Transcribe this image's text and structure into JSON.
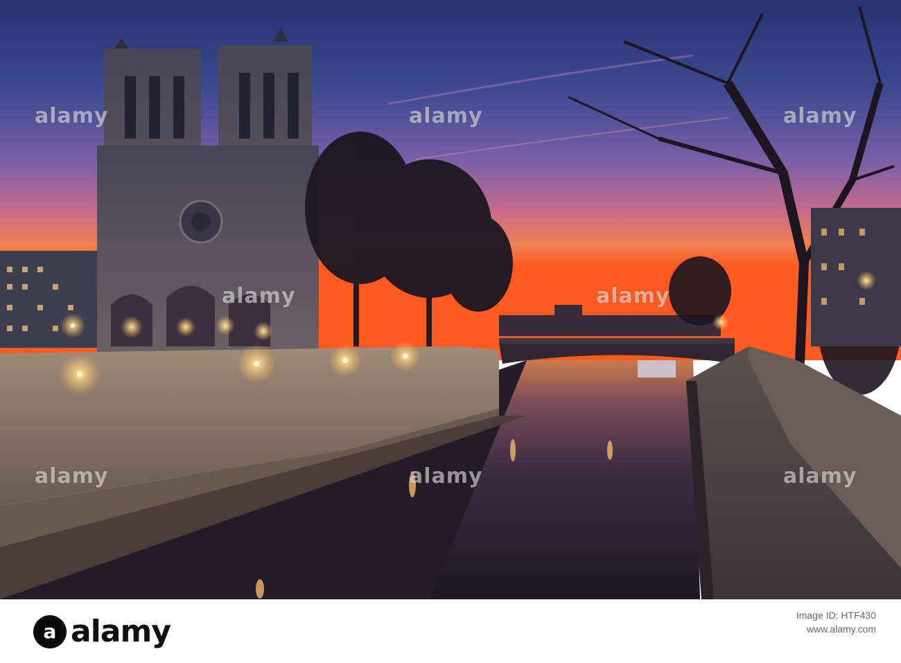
{
  "watermark": {
    "text": "alamy"
  },
  "footer": {
    "brand_text": "alamy",
    "brand_mark": "a",
    "image_id_label": "Image ID: HTF430",
    "url": "www.alamy.com"
  },
  "colors": {
    "sky_top": "#2f3a77",
    "sky_mid": "#8b5a9f",
    "sky_horizon": "#f2703d",
    "stone": "#8a7566",
    "lamp": "#ffc86a",
    "water": "#2a2233"
  }
}
